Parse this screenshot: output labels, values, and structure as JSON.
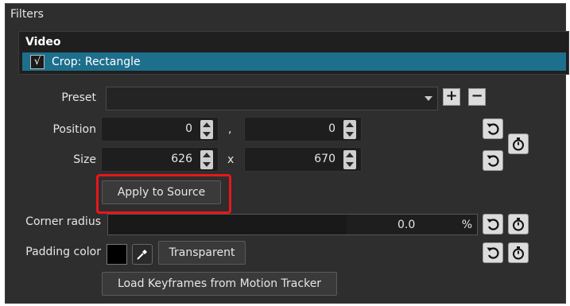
{
  "panel": {
    "title": "Filters"
  },
  "filters_list": {
    "header": "Video",
    "items": [
      {
        "label": "Crop: Rectangle",
        "checked": true,
        "check_glyph": "√"
      }
    ]
  },
  "preset": {
    "label": "Preset",
    "value": "",
    "add_symbol": "+",
    "remove_symbol": "−"
  },
  "position": {
    "label": "Position",
    "x": "0",
    "separator": ",",
    "y": "0"
  },
  "size": {
    "label": "Size",
    "width": "626",
    "separator": "x",
    "height": "670"
  },
  "apply_button": {
    "label": "Apply to Source",
    "highlighted": true,
    "highlight_color": "#e8161b"
  },
  "corner_radius": {
    "label": "Corner radius",
    "value": "0.0",
    "unit": "%"
  },
  "padding_color": {
    "label": "Padding color",
    "swatch_color": "#000000",
    "transparent_label": "Transparent"
  },
  "keyframes_button": {
    "label": "Load Keyframes from Motion Tracker"
  },
  "icons": {
    "reset": "reset-icon",
    "keyframe": "stopwatch-icon",
    "eyedropper": "eyedropper-icon"
  },
  "colors": {
    "selection": "#1d6f8c",
    "panel_bg": "#2e2e2e"
  }
}
